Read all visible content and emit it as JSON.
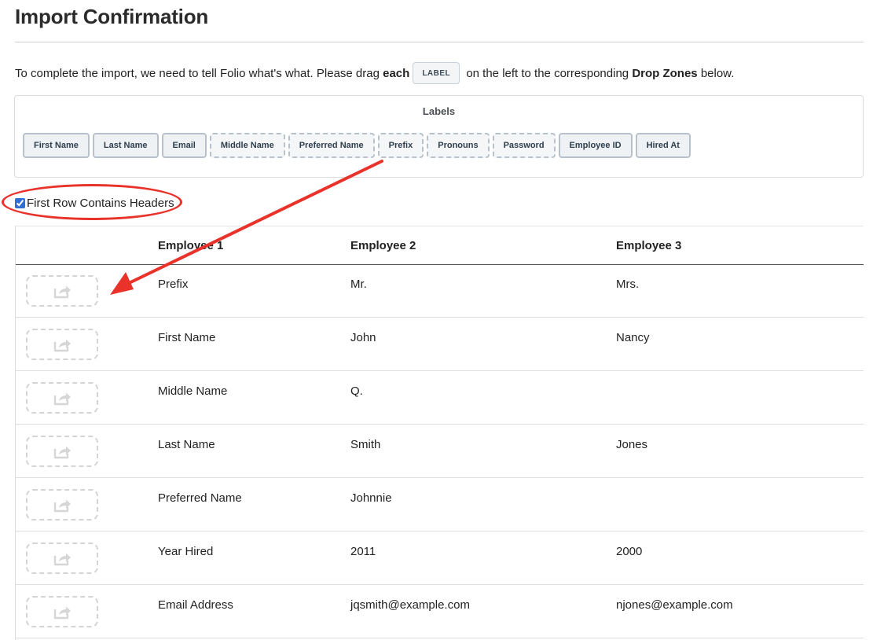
{
  "page": {
    "title": "Import Confirmation"
  },
  "instructions": {
    "part1": "To complete the import, we need to tell Folio what's what. Please drag ",
    "bold1": "each",
    "chip": "LABEL",
    "part2": " on the left to the corresponding ",
    "bold2": "Drop Zones",
    "part3": " below."
  },
  "labels_panel": {
    "heading": "Labels",
    "chips": [
      {
        "label": "First Name",
        "placed": false
      },
      {
        "label": "Last Name",
        "placed": false
      },
      {
        "label": "Email",
        "placed": false
      },
      {
        "label": "Middle Name",
        "placed": true
      },
      {
        "label": "Preferred Name",
        "placed": true
      },
      {
        "label": "Prefix",
        "placed": true
      },
      {
        "label": "Pronouns",
        "placed": true
      },
      {
        "label": "Password",
        "placed": true
      },
      {
        "label": "Employee ID",
        "placed": false
      },
      {
        "label": "Hired At",
        "placed": false
      }
    ]
  },
  "header_toggle": {
    "label": "First Row Contains Headers",
    "checked": true
  },
  "table": {
    "columns": [
      "Employee 1",
      "Employee 2",
      "Employee 3"
    ],
    "rows": [
      {
        "cells": [
          "Prefix",
          "Mr.",
          "Mrs."
        ]
      },
      {
        "cells": [
          "First Name",
          "John",
          "Nancy"
        ]
      },
      {
        "cells": [
          "Middle Name",
          "Q.",
          ""
        ]
      },
      {
        "cells": [
          "Last Name",
          "Smith",
          "Jones"
        ]
      },
      {
        "cells": [
          "Preferred Name",
          "Johnnie",
          ""
        ]
      },
      {
        "cells": [
          "Year Hired",
          "2011",
          "2000"
        ]
      },
      {
        "cells": [
          "Email Address",
          "jqsmith@example.com",
          "njones@example.com"
        ]
      }
    ]
  },
  "icons": {
    "drop_zone": "share-export-icon"
  },
  "colors": {
    "annotation": "#e8322a",
    "chip_border": "#b7c2cc",
    "drop_zone_border": "#d4d4d4"
  }
}
